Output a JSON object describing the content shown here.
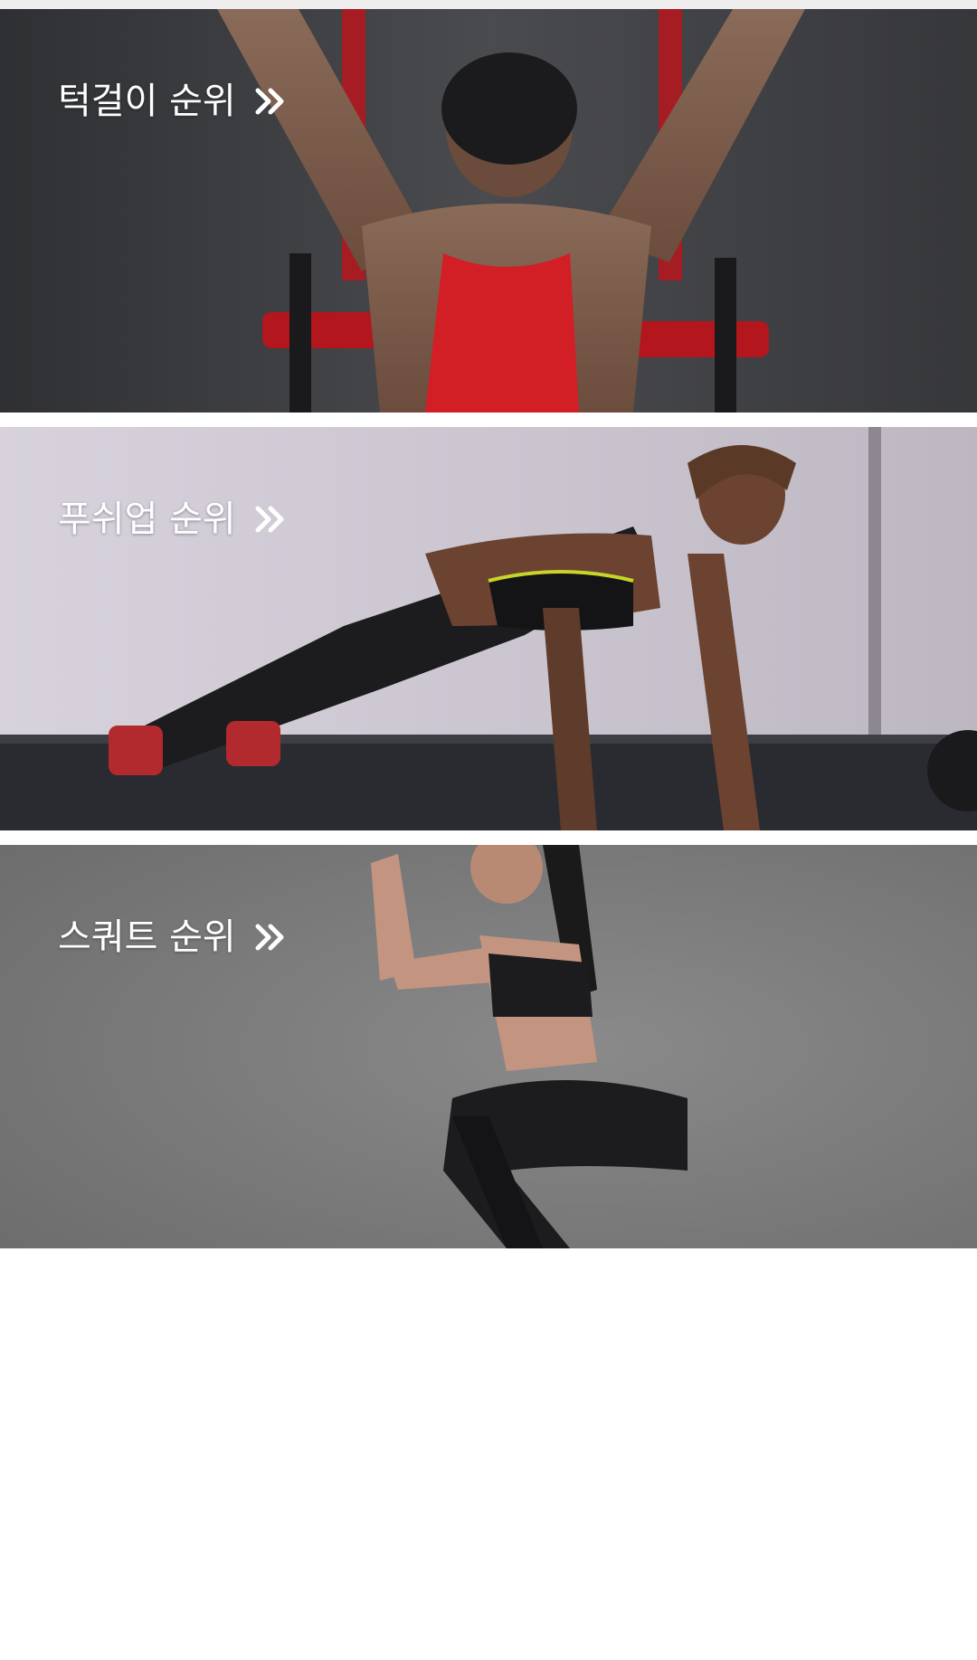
{
  "rankings": [
    {
      "label": "턱걸이 순위",
      "icon": "double-chevron-right-icon",
      "image": "pull-up-photo"
    },
    {
      "label": "푸쉬업 순위",
      "icon": "double-chevron-right-icon",
      "image": "push-up-photo"
    },
    {
      "label": "스쿼트 순위",
      "icon": "double-chevron-right-icon",
      "image": "squat-photo"
    }
  ],
  "colors": {
    "banner1_bg": "#3d3e42",
    "banner2_bg": "#cfc9d4",
    "banner3_bg": "#7a7a7b",
    "title_text": "#ffffff",
    "tank_red": "#d21f26"
  }
}
